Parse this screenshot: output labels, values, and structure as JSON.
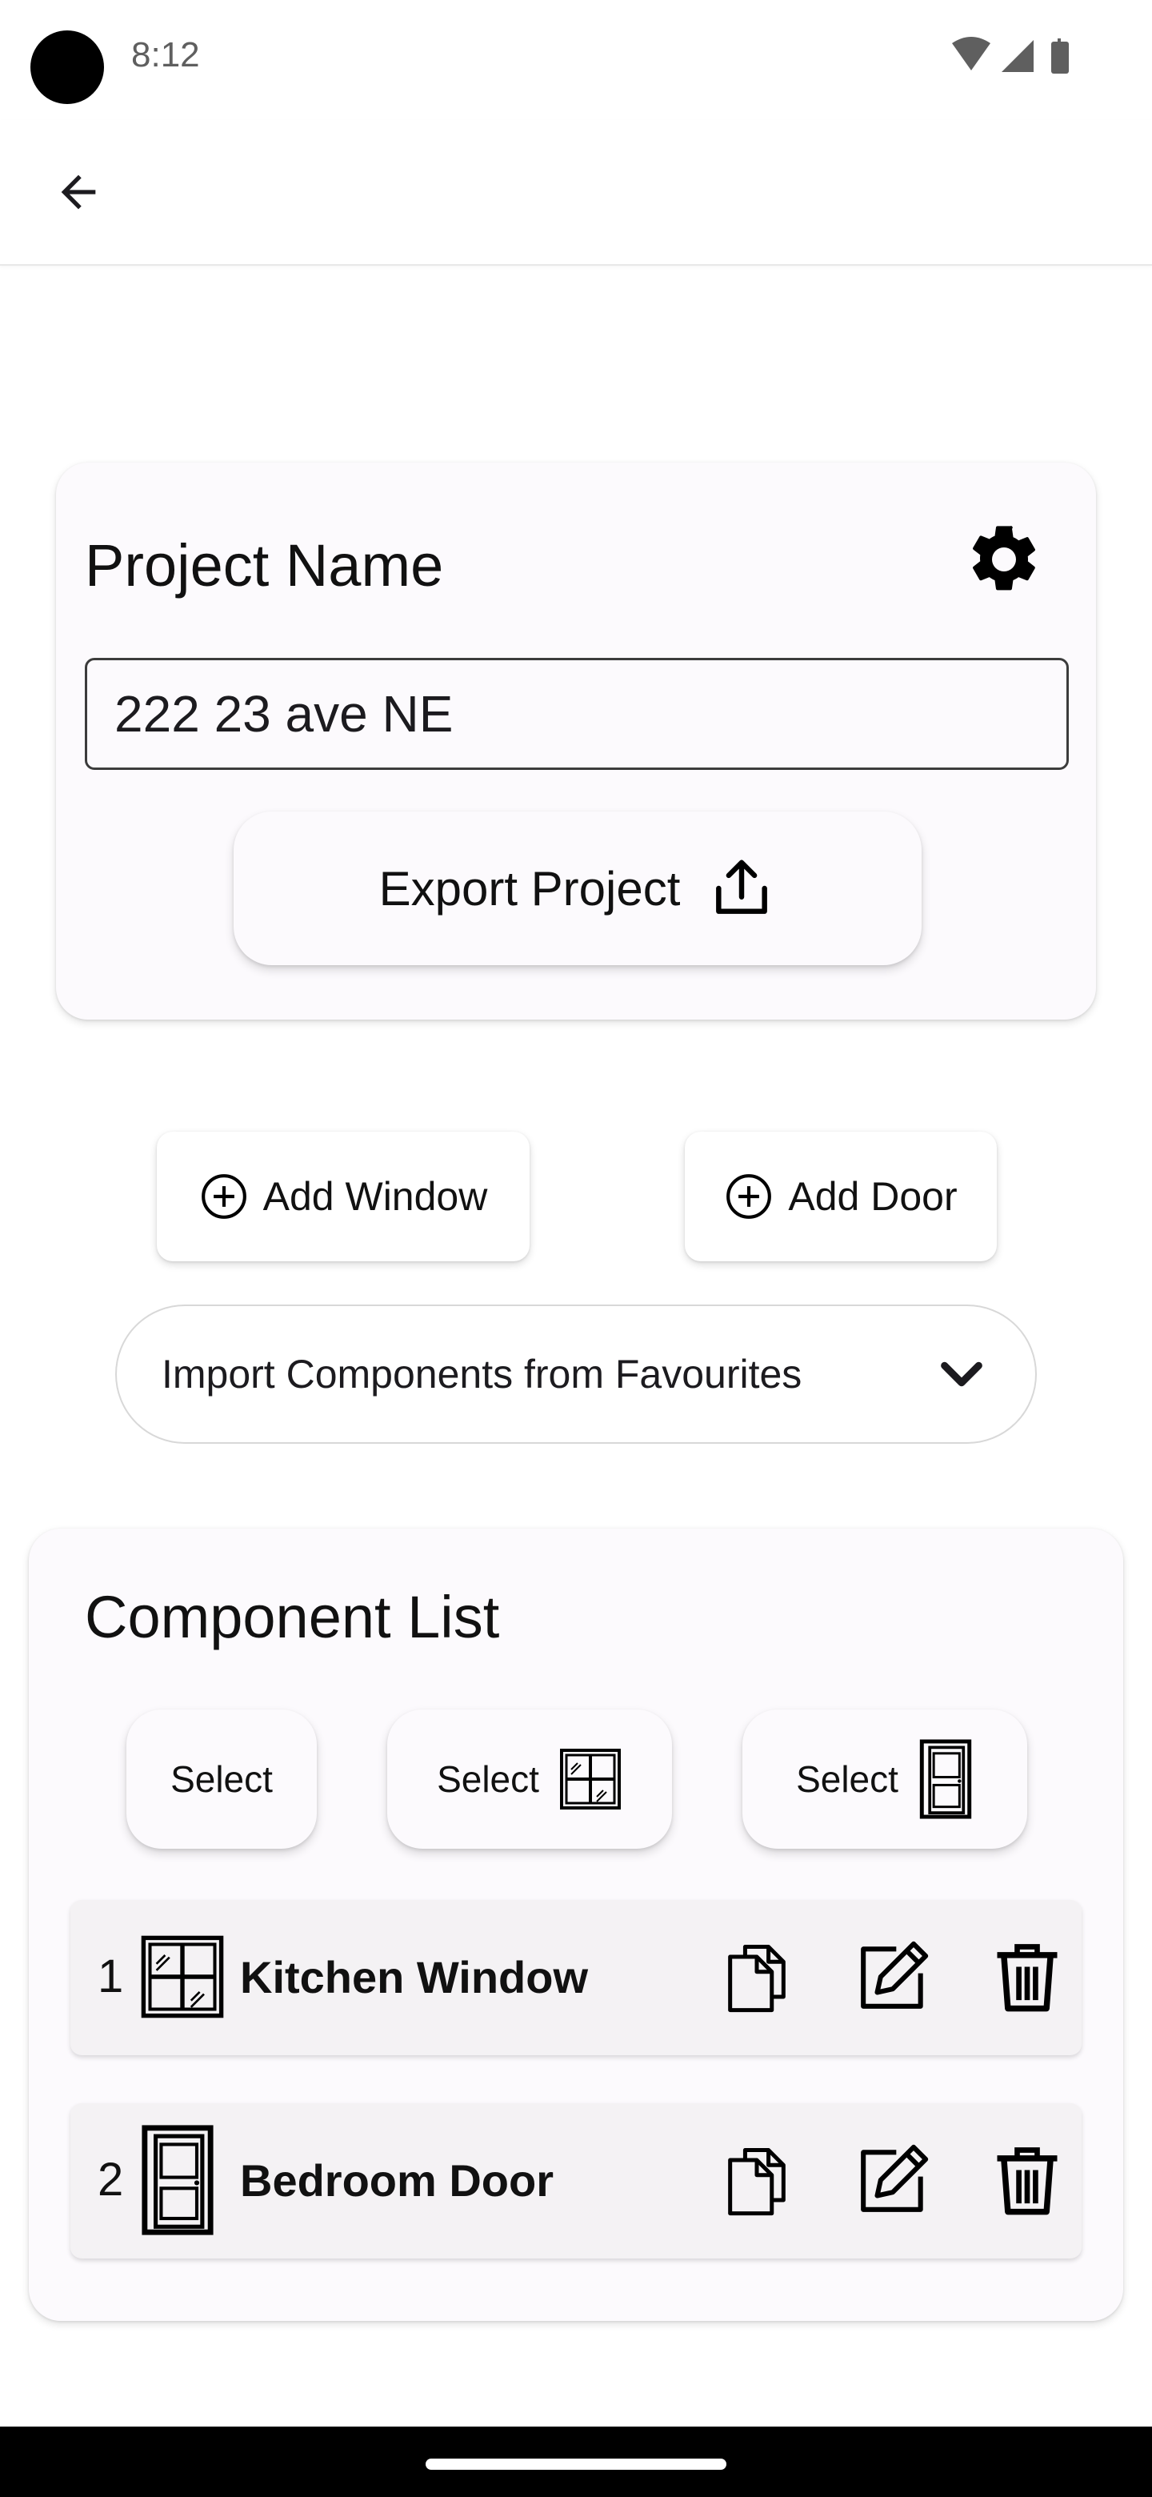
{
  "status_bar": {
    "time": "8:12",
    "icons": [
      "wifi-icon",
      "signal-icon",
      "battery-icon"
    ]
  },
  "app_bar": {
    "back_icon": "arrow-left-icon"
  },
  "project": {
    "title": "Project Name",
    "settings_icon": "gear-icon",
    "name_value": "222 23 ave NE",
    "export_label": "Export Project",
    "export_icon": "share-upload-icon"
  },
  "actions": {
    "add_window_label": "Add Window",
    "add_door_label": "Add Door",
    "add_icon": "plus-circle-icon"
  },
  "import": {
    "label": "Import Components from Favourites",
    "icon": "chevron-down-icon"
  },
  "component_list": {
    "title": "Component List",
    "select_buttons": [
      {
        "label": "Select",
        "icon": ""
      },
      {
        "label": "Select",
        "icon": "window-icon"
      },
      {
        "label": "Select",
        "icon": "door-icon"
      }
    ],
    "rows": [
      {
        "index": "1",
        "type_icon": "window-icon",
        "name": "Kitchen Window"
      },
      {
        "index": "2",
        "type_icon": "door-icon",
        "name": "Bedroom Door"
      }
    ],
    "row_action_icons": [
      "copy-icon",
      "edit-icon",
      "trash-icon"
    ]
  },
  "colors": {
    "card_background": "#fcfafd",
    "text": "#1c1b1f",
    "nav_bar": "#000000"
  }
}
